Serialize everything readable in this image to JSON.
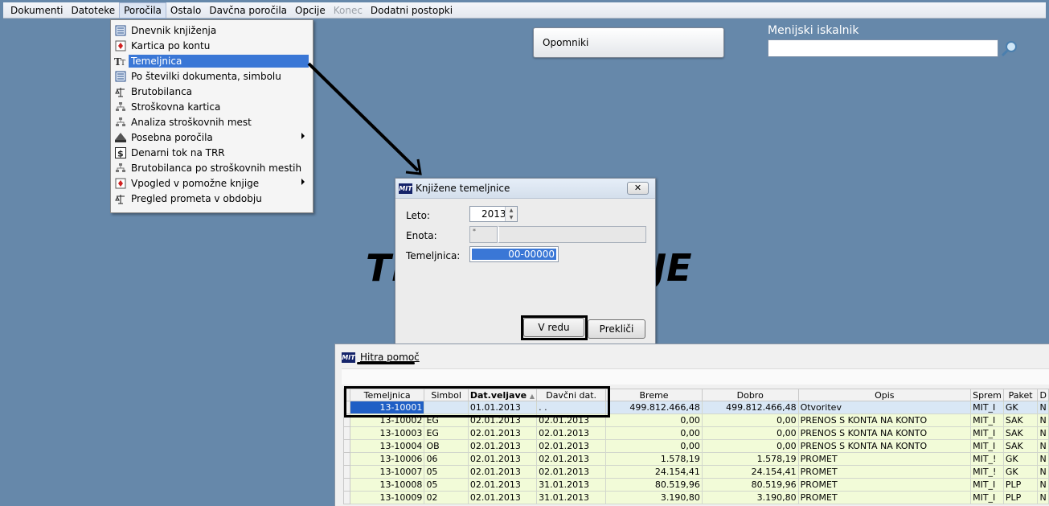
{
  "menubar": {
    "items": [
      {
        "label": "Dokumenti"
      },
      {
        "label": "Datoteke"
      },
      {
        "label": "Poročila"
      },
      {
        "label": "Ostalo"
      },
      {
        "label": "Davčna poročila"
      },
      {
        "label": "Opcije"
      },
      {
        "label": "Konec"
      },
      {
        "label": "Dodatni postopki"
      }
    ]
  },
  "dropdown": {
    "items": [
      {
        "label": "Dnevnik knjiženja",
        "icon": "journal-icon"
      },
      {
        "label": "Kartica po kontu",
        "icon": "card-icon"
      },
      {
        "label": "Temeljnica",
        "icon": "text-icon"
      },
      {
        "label": "Po številki dokumenta, simbolu",
        "icon": "journal-icon"
      },
      {
        "label": "Brutobilanca",
        "icon": "scale-icon"
      },
      {
        "label": "Stroškovna kartica",
        "icon": "hierarchy-icon"
      },
      {
        "label": "Analiza stroškovnih mest",
        "icon": "hierarchy-icon"
      },
      {
        "label": "Posebna poročila",
        "icon": "durs-icon"
      },
      {
        "label": "Denarni tok na TRR",
        "icon": "dollar-icon"
      },
      {
        "label": "Brutobilanca po stroškovnih mestih",
        "icon": "hierarchy-icon"
      },
      {
        "label": "Vpogled v pomožne knjige",
        "icon": "card-icon"
      },
      {
        "label": "Pregled prometa v obdobju",
        "icon": "scale-icon"
      }
    ]
  },
  "opomniki": {
    "label": "Opomniki"
  },
  "menu_search": {
    "title": "Menijski iskalnik",
    "value": ""
  },
  "background_text": {
    "left": "TE",
    "right": "JE"
  },
  "dialog": {
    "title": "Knjižene temeljnice",
    "app_icon_text": "MIT",
    "close_glyph": "✕",
    "labels": {
      "leto": "Leto:",
      "enota": "Enota:",
      "temeljnica": "Temeljnica:"
    },
    "leto_value": "2013",
    "enota_value": "*",
    "temeljnica_value": "00-00000",
    "ok_label": "V redu",
    "cancel_label": "Prekliči"
  },
  "quick_help": {
    "title": "Hitra pomoč",
    "app_icon_text": "MIT",
    "columns": [
      "Temeljnica",
      "Simbol",
      "Dat.veljave",
      "Davčni dat.",
      "Breme",
      "Dobro",
      "Opis",
      "Sprem",
      "Paket",
      "D"
    ],
    "rows": [
      [
        "13-10001",
        "",
        "01.01.2013",
        ". .",
        "499.812.466,48",
        "499.812.466,48",
        "Otvoritev",
        "MIT_I",
        "GK",
        "N"
      ],
      [
        "13-10002",
        "EG",
        "02.01.2013",
        "02.01.2013",
        "0,00",
        "0,00",
        "PRENOS S KONTA NA KONTO",
        "MIT_I",
        "SAK",
        "N"
      ],
      [
        "13-10003",
        "EG",
        "02.01.2013",
        "02.01.2013",
        "0,00",
        "0,00",
        "PRENOS S KONTA NA KONTO",
        "MIT_I",
        "SAK",
        "N"
      ],
      [
        "13-10004",
        "OB",
        "02.01.2013",
        "02.01.2013",
        "0,00",
        "0,00",
        "PRENOS S KONTA NA KONTO",
        "MIT_I",
        "SAK",
        "N"
      ],
      [
        "13-10006",
        "06",
        "02.01.2013",
        "02.01.2013",
        "1.578,19",
        "1.578,19",
        "PROMET",
        "MIT_!",
        "GK",
        "N"
      ],
      [
        "13-10007",
        "05",
        "02.01.2013",
        "02.01.2013",
        "24.154,41",
        "24.154,41",
        "PROMET",
        "MIT_!",
        "GK",
        "N"
      ],
      [
        "13-10008",
        "05",
        "02.01.2013",
        "31.01.2013",
        "80.519,96",
        "80.519,96",
        "PROMET",
        "MIT_I",
        "PLP",
        "N"
      ],
      [
        "13-10009",
        "02",
        "02.01.2013",
        "31.01.2013",
        "3.190,80",
        "3.190,80",
        "PROMET",
        "MIT_I",
        "PLP",
        "N"
      ]
    ]
  },
  "colors": {
    "desktop": "#6688aa",
    "selection": "#3a77d6",
    "row_green": "#f2fbd8"
  }
}
